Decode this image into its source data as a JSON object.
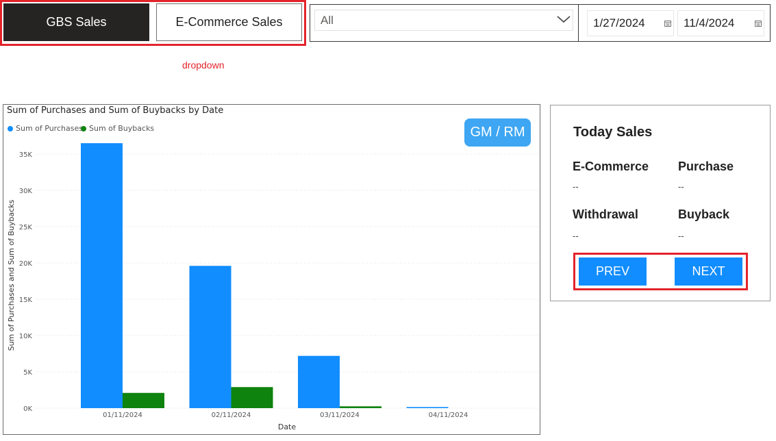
{
  "toggle": {
    "gbs_label": "GBS Sales",
    "ecommerce_label": "E-Commerce Sales",
    "note": "dropdown"
  },
  "filters": {
    "select_value": "All",
    "date_start": "1/27/2024",
    "date_end": "11/4/2024"
  },
  "chart_button": {
    "label": "GM / RM"
  },
  "today_sales": {
    "title": "Today Sales",
    "ecommerce_label": "E-Commerce",
    "ecommerce_value": "--",
    "purchase_label": "Purchase",
    "purchase_value": "--",
    "withdrawal_label": "Withdrawal",
    "withdrawal_value": "--",
    "buyback_label": "Buyback",
    "buyback_value": "--",
    "prev_label": "PREV",
    "next_label": "NEXT"
  },
  "colors": {
    "purchases": "#118dff",
    "buybacks": "#0e830e",
    "accent_red": "#e3242b",
    "gm_button": "#3ea6f2"
  },
  "chart_data": {
    "type": "bar",
    "title": "Sum of Purchases and Sum of Buybacks by Date",
    "xlabel": "Date",
    "ylabel": "Sum of Purchases and Sum of Buybacks",
    "categories": [
      "01/11/2024",
      "02/11/2024",
      "03/11/2024",
      "04/11/2024"
    ],
    "series": [
      {
        "name": "Sum of Purchases",
        "values": [
          36500,
          19600,
          7200,
          150
        ]
      },
      {
        "name": "Sum of Buybacks",
        "values": [
          2100,
          2900,
          250,
          0
        ]
      }
    ],
    "ylim": [
      0,
      35000
    ],
    "yticks": [
      "0K",
      "5K",
      "10K",
      "15K",
      "20K",
      "25K",
      "30K",
      "35K"
    ],
    "grid": true,
    "legend": "top-left"
  }
}
